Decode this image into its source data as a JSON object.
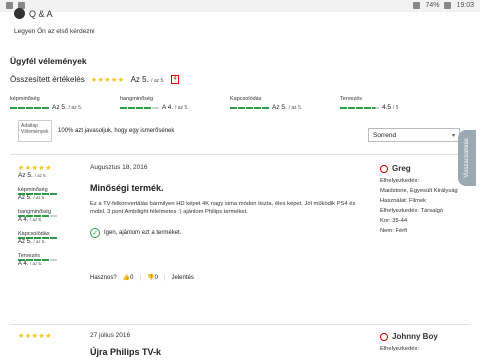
{
  "statusbar": {
    "battery": "74%",
    "time": "19:03"
  },
  "qa": {
    "label": "Q & A",
    "first_question": "Legyen Ön az első kérdezni"
  },
  "section_title": "Ügyfél vélemények",
  "overall": {
    "label": "Összesített értékelés",
    "score": "Az 5.",
    "score_suffix": "/ az 5.",
    "count_badge": "4"
  },
  "metrics": [
    {
      "label": "képminőség",
      "value": "Az 5.",
      "suffix": "/ az 5.",
      "filled": 5
    },
    {
      "label": "hangminőség",
      "value": "A 4.",
      "suffix": "/ az 5.",
      "filled": 4
    },
    {
      "label": "Kapcsolódás",
      "value": "Az 5.",
      "suffix": "/ az 5.",
      "filled": 5
    },
    {
      "label": "Tervezés",
      "value": "4.5",
      "suffix": "/ 5",
      "filled": 4.5
    }
  ],
  "recommend": {
    "image_alt": "Adatlap Vélemények",
    "text": "100% azt javasoljuk, hogy egy ismerősének"
  },
  "sort": {
    "label": "Sorrend"
  },
  "side_tab": {
    "label": "Visszacsatolás"
  },
  "reviews": [
    {
      "score": "Az 5.",
      "score_suffix": "/ az 5.",
      "mini": [
        {
          "label": "képminőség",
          "value": "Az 5.",
          "suffix": "/ az 5."
        },
        {
          "label": "hangminőség",
          "value": "A 4.",
          "suffix": "/ az 5."
        },
        {
          "label": "Kapcsolódás",
          "value": "Az 5.",
          "suffix": "/ az 5."
        },
        {
          "label": "Tervezés",
          "value": "A 4.",
          "suffix": "/ az 5."
        }
      ],
      "date": "Augusztus 18, 2016",
      "title": "Minőségi termék.",
      "body": "Ez a TV-felkonvertálás bármilyen HD képet 4K nagy sima módon tiszta, éles képet. Jól működik PS4 és mobil. 3 pont Ambilight félelmetes :) ajánlom Philips terméket.",
      "recommend_text": "Igen, ajánlom ezt a terméket.",
      "helpful_label": "Hasznos?",
      "helpful_yes": "0",
      "helpful_no": "0",
      "report": "Jelentés",
      "author": "Greg",
      "meta": [
        "Elhelyezkedés:",
        "Maidstone, Egyesült Királyság",
        "Használat: Filmek",
        "Elhelyezkedés: Társalgó",
        "Kor: 35-44",
        "Nem: Férfi"
      ]
    },
    {
      "date": "27 július 2016",
      "title": "Újra Philips TV-k",
      "author": "Johnny Boy",
      "meta": [
        "Elhelyezkedés:"
      ]
    }
  ]
}
